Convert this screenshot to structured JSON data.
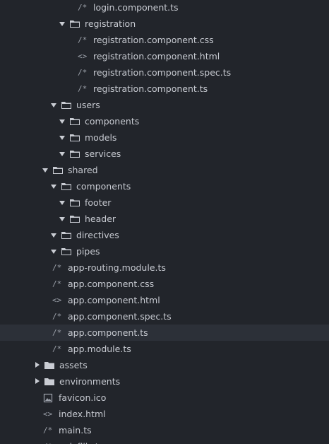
{
  "colors": {
    "background": "#22252b",
    "selected_row": "#2c3038",
    "text": "#c7cad1",
    "icon": "#9ba0a9",
    "folder_icon": "#c9ccd3"
  },
  "tree": {
    "rows": [
      {
        "kind": "file",
        "icon": "code-comment-icon",
        "glyph": "/*",
        "label": "login.component.ts"
      },
      {
        "kind": "folder",
        "expanded": true,
        "label": "registration"
      },
      {
        "kind": "file",
        "icon": "code-comment-icon",
        "glyph": "/*",
        "label": "registration.component.css"
      },
      {
        "kind": "file",
        "icon": "code-brackets-icon",
        "glyph": "<>",
        "label": "registration.component.html"
      },
      {
        "kind": "file",
        "icon": "code-comment-icon",
        "glyph": "/*",
        "label": "registration.component.spec.ts"
      },
      {
        "kind": "file",
        "icon": "code-comment-icon",
        "glyph": "/*",
        "label": "registration.component.ts"
      },
      {
        "kind": "folder",
        "expanded": true,
        "label": "users"
      },
      {
        "kind": "folder",
        "expanded": true,
        "label": "components"
      },
      {
        "kind": "folder",
        "expanded": true,
        "label": "models"
      },
      {
        "kind": "folder",
        "expanded": true,
        "label": "services"
      },
      {
        "kind": "folder",
        "expanded": true,
        "label": "shared"
      },
      {
        "kind": "folder",
        "expanded": true,
        "label": "components"
      },
      {
        "kind": "folder",
        "expanded": true,
        "label": "footer"
      },
      {
        "kind": "folder",
        "expanded": true,
        "label": "header"
      },
      {
        "kind": "folder",
        "expanded": true,
        "label": "directives"
      },
      {
        "kind": "folder",
        "expanded": true,
        "label": "pipes"
      },
      {
        "kind": "file",
        "icon": "code-comment-icon",
        "glyph": "/*",
        "label": "app-routing.module.ts"
      },
      {
        "kind": "file",
        "icon": "code-comment-icon",
        "glyph": "/*",
        "label": "app.component.css"
      },
      {
        "kind": "file",
        "icon": "code-brackets-icon",
        "glyph": "<>",
        "label": "app.component.html"
      },
      {
        "kind": "file",
        "icon": "code-comment-icon",
        "glyph": "/*",
        "label": "app.component.spec.ts"
      },
      {
        "kind": "file",
        "icon": "code-comment-icon",
        "glyph": "/*",
        "label": "app.component.ts",
        "selected": true
      },
      {
        "kind": "file",
        "icon": "code-comment-icon",
        "glyph": "/*",
        "label": "app.module.ts"
      },
      {
        "kind": "folder",
        "expanded": false,
        "label": "assets"
      },
      {
        "kind": "folder",
        "expanded": false,
        "label": "environments"
      },
      {
        "kind": "file",
        "icon": "image-icon",
        "glyph": "",
        "label": "favicon.ico"
      },
      {
        "kind": "file",
        "icon": "code-brackets-icon",
        "glyph": "<>",
        "label": "index.html"
      },
      {
        "kind": "file",
        "icon": "code-comment-icon",
        "glyph": "/*",
        "label": "main.ts"
      },
      {
        "kind": "file",
        "icon": "code-comment-icon",
        "glyph": "/*",
        "label": "polyfills.ts"
      }
    ]
  }
}
